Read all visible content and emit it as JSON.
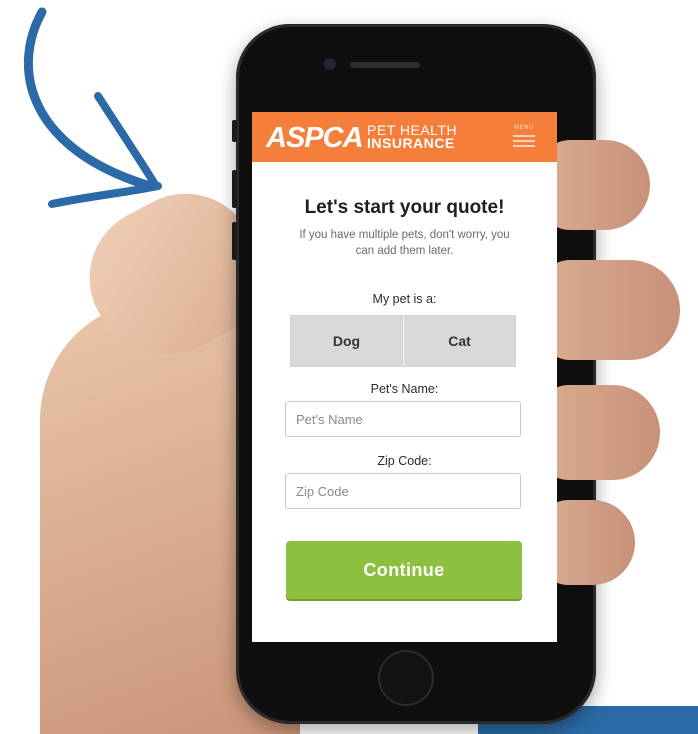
{
  "header": {
    "logo": "ASPCA",
    "logo_sub_line1": "PET HEALTH",
    "logo_sub_line2": "INSURANCE",
    "menu_label": "MENU",
    "background_color": "#f47e3a"
  },
  "form": {
    "title": "Let's start your quote!",
    "subtitle": "If you have multiple pets, don't worry, you can add them later.",
    "pet_type_label": "My pet is a:",
    "pet_type_options": [
      "Dog",
      "Cat"
    ],
    "pet_name_label": "Pet's Name:",
    "pet_name_placeholder": "Pet's Name",
    "zip_label": "Zip Code:",
    "zip_placeholder": "Zip Code",
    "continue_label": "Continue",
    "continue_color": "#8dc03f"
  },
  "icons": {
    "arrow": "curved-arrow-icon",
    "menu": "hamburger-menu-icon"
  },
  "colors": {
    "arrow_blue": "#2b6aa6",
    "toggle_gray": "#d9d9d9"
  }
}
